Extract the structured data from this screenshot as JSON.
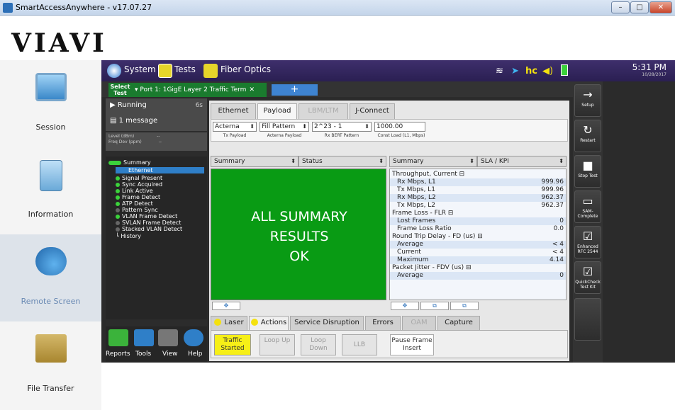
{
  "window": {
    "title": "SmartAccessAnywhere - v17.07.27",
    "controls": [
      "–",
      "□",
      "✕"
    ]
  },
  "brand": {
    "logo": "VIAVI"
  },
  "leftnav": {
    "items": [
      {
        "label": "Session",
        "icon": "monitor-icon"
      },
      {
        "label": "Information",
        "icon": "info-icon"
      },
      {
        "label": "Remote Screen",
        "icon": "remote-screen-icon",
        "active": true
      },
      {
        "label": "File Transfer",
        "icon": "folder-icon"
      }
    ]
  },
  "device": {
    "topbar": {
      "system": "System",
      "tests": "Tests",
      "fiber": "Fiber Optics",
      "time": "5:31 PM",
      "date": "10/28/2017"
    },
    "tabs": {
      "select_test": "Select Test",
      "port": "Port 1: 1GigE Layer 2 Traffic Term",
      "add": "+"
    },
    "status": {
      "running": "Running",
      "running_count": "6s",
      "message": "1 message",
      "level": "Level (dBm)",
      "level_val": "--",
      "freq": "Freq Dev (ppm)",
      "freq_val": "--"
    },
    "tree": {
      "summary": "Summary",
      "ethernet": "Ethernet",
      "items": [
        "Signal Present",
        "Sync Acquired",
        "Link Active",
        "Frame Detect",
        "ATP Detect",
        "Pattern Sync",
        "VLAN Frame Detect",
        "SVLAN Frame Detect",
        "Stacked VLAN Detect"
      ],
      "history": "History"
    },
    "bottom_icons": [
      "Reports",
      "Tools",
      "View",
      "Help"
    ],
    "subtabs": [
      "Ethernet",
      "Payload",
      "LBM/LTM",
      "J-Connect"
    ],
    "payload": {
      "fields": [
        {
          "value": "Acterna",
          "label": "Tx Payload"
        },
        {
          "value": "Fill Pattern",
          "label": "Acterna Payload"
        },
        {
          "value": "2^23 - 1",
          "label": "Rx BERT Pattern"
        },
        {
          "value": "1000.00",
          "label": "Const Load (L1, Mbps)"
        }
      ]
    },
    "left_results": {
      "col1": "Summary",
      "col2": "Status",
      "message": [
        "ALL SUMMARY",
        "RESULTS",
        "OK"
      ]
    },
    "right_results": {
      "col1": "Summary",
      "col2": "SLA / KPI",
      "rows": [
        {
          "k": "Throughput, Current ⊟",
          "v": "",
          "h": true
        },
        {
          "k": "Rx Mbps, L1",
          "v": "999.96"
        },
        {
          "k": "Tx Mbps, L1",
          "v": "999.96"
        },
        {
          "k": "Rx Mbps, L2",
          "v": "962.37"
        },
        {
          "k": "Tx Mbps, L2",
          "v": "962.37"
        },
        {
          "k": "Frame Loss - FLR ⊟",
          "v": "",
          "h": true
        },
        {
          "k": "Lost Frames",
          "v": "0"
        },
        {
          "k": "Frame Loss Ratio",
          "v": "0.0"
        },
        {
          "k": "Round Trip Delay - FD (us) ⊟",
          "v": "",
          "h": true
        },
        {
          "k": "Average",
          "v": "< 4"
        },
        {
          "k": "Current",
          "v": "< 4"
        },
        {
          "k": "Maximum",
          "v": "4.14"
        },
        {
          "k": "Packet Jitter - FDV (us) ⊟",
          "v": "",
          "h": true
        },
        {
          "k": "Average",
          "v": "0"
        }
      ]
    },
    "action_tabs": [
      "Laser",
      "Actions",
      "Service Disruption",
      "Errors",
      "OAM",
      "Capture"
    ],
    "action_buttons": [
      {
        "label": "Traffic Started",
        "state": "on"
      },
      {
        "label": "Loop Up",
        "state": "dis"
      },
      {
        "label": "Loop Down",
        "state": "dis"
      },
      {
        "label": "LLB",
        "state": "dis"
      },
      {
        "label": "Pause Frame Insert",
        "state": "en"
      }
    ],
    "right_buttons": [
      {
        "label": "Setup",
        "icon": "→"
      },
      {
        "label": "Restart",
        "icon": "↻"
      },
      {
        "label": "Stop Test",
        "icon": "■"
      },
      {
        "label": "SAM-Complete",
        "icon": "▭"
      },
      {
        "label": "Enhanced RFC 2544",
        "icon": "☑"
      },
      {
        "label": "QuickCheck Test Kit",
        "icon": "☑"
      }
    ]
  }
}
